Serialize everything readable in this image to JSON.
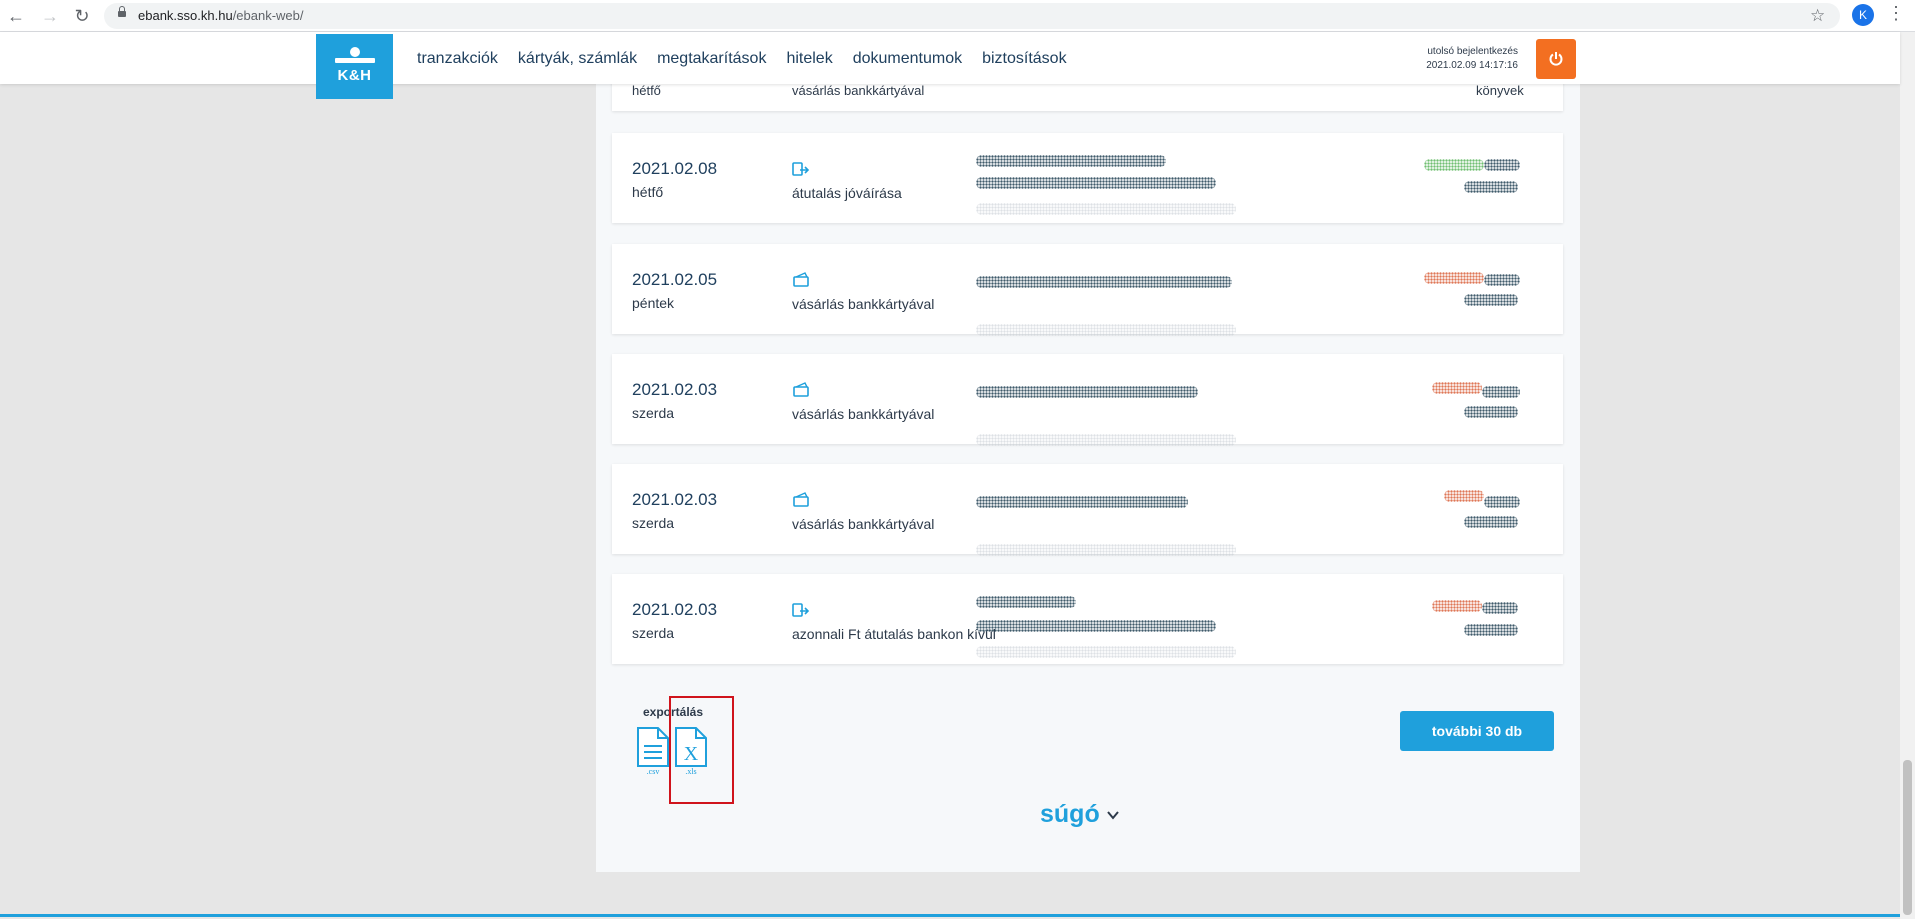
{
  "browser": {
    "url_host": "ebank.sso.kh.hu",
    "url_path": "/ebank-web/",
    "profile_initial": "K",
    "icons": [
      "back-arrow-icon",
      "forward-arrow-icon",
      "reload-icon",
      "lock-icon",
      "star-icon",
      "kebab-menu-icon"
    ]
  },
  "header": {
    "logo_text": "K&H",
    "nav": [
      "tranzakciók",
      "kártyák, számlák",
      "megtakarítások",
      "hitelek",
      "dokumentumok",
      "biztosítások"
    ],
    "last_login_label": "utolsó bejelentkezés",
    "last_login_value": "2021.02.09 14:17:16",
    "colors": {
      "brand": "#1fa0dc",
      "power": "#f36f21"
    }
  },
  "partial_row": {
    "day": "hétfő",
    "type": "vásárlás bankkártyával",
    "category": "könyvek"
  },
  "transactions": [
    {
      "date": "2021.02.08",
      "day": "hétfő",
      "type": "átutalás jóváírása",
      "icon": "transfer-icon",
      "amount_color": "green"
    },
    {
      "date": "2021.02.05",
      "day": "péntek",
      "type": "vásárlás bankkártyával",
      "icon": "card-icon",
      "amount_color": "orange"
    },
    {
      "date": "2021.02.03",
      "day": "szerda",
      "type": "vásárlás bankkártyával",
      "icon": "card-icon",
      "amount_color": "orange"
    },
    {
      "date": "2021.02.03",
      "day": "szerda",
      "type": "vásárlás bankkártyával",
      "icon": "card-icon",
      "amount_color": "orange"
    },
    {
      "date": "2021.02.03",
      "day": "szerda",
      "type": "azonnali Ft átutalás bankon kívül",
      "icon": "transfer-icon",
      "amount_color": "orange"
    }
  ],
  "export": {
    "label": "exportálás",
    "csv_label": ".csv",
    "xls_label": ".xls",
    "xls_letter": "X"
  },
  "more_button": "további 30 db",
  "help_label": "súgó"
}
